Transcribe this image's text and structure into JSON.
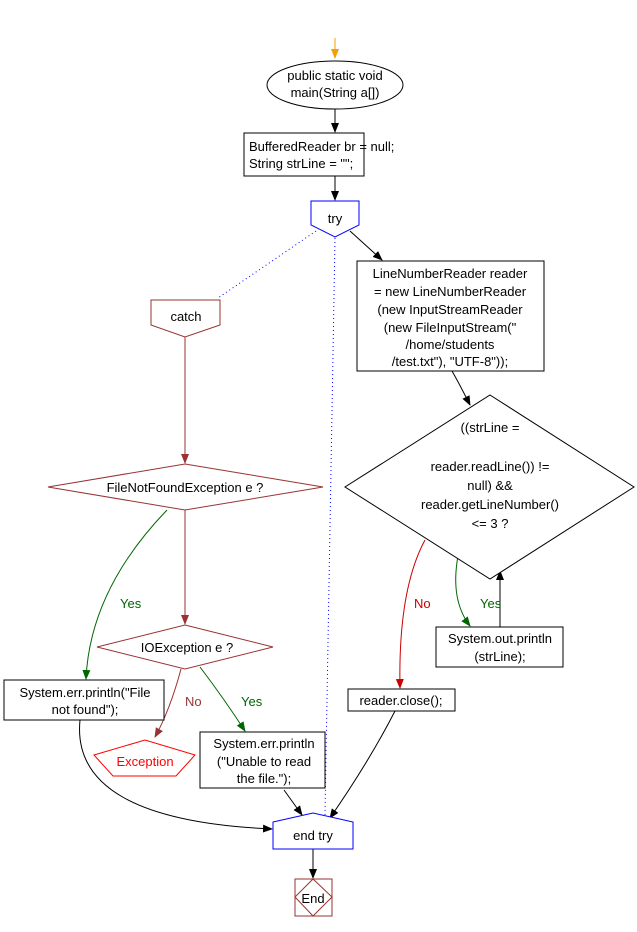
{
  "colors": {
    "start_arrow": "#f5a000",
    "try_blocks": "#0000ff",
    "catch_blocks": "#993333",
    "yes": "#006600",
    "no": "#cc0000",
    "exception": "#ff0000"
  },
  "nodes": {
    "start": [
      "public static void",
      "main(String a[])"
    ],
    "declare": [
      "BufferedReader br = null;",
      "String strLine = \"\";"
    ],
    "try": "try",
    "reader": [
      "LineNumberReader reader",
      "= new LineNumberReader",
      "(new InputStreamReader",
      "(new FileInputStream(\"",
      "/home/students",
      "/test.txt\"), \"UTF-8\"));"
    ],
    "loop_condition": [
      "((strLine =",
      "reader.readLine()) !=",
      "null) &&",
      "reader.getLineNumber()",
      "<= 3 ?"
    ],
    "print_line": [
      "System.out.println",
      "(strLine);"
    ],
    "close": "reader.close();",
    "catch": "catch",
    "fnf_condition": "FileNotFoundException e ?",
    "io_condition": "IOException e ?",
    "fnf_print": [
      "System.err.println(\"File",
      "not found\");"
    ],
    "exception": "Exception",
    "io_print": [
      "System.err.println",
      "(\"Unable to read",
      "the file.\");"
    ],
    "end_try": "end try",
    "end": "End"
  },
  "labels": {
    "yes": "Yes",
    "no": "No"
  }
}
